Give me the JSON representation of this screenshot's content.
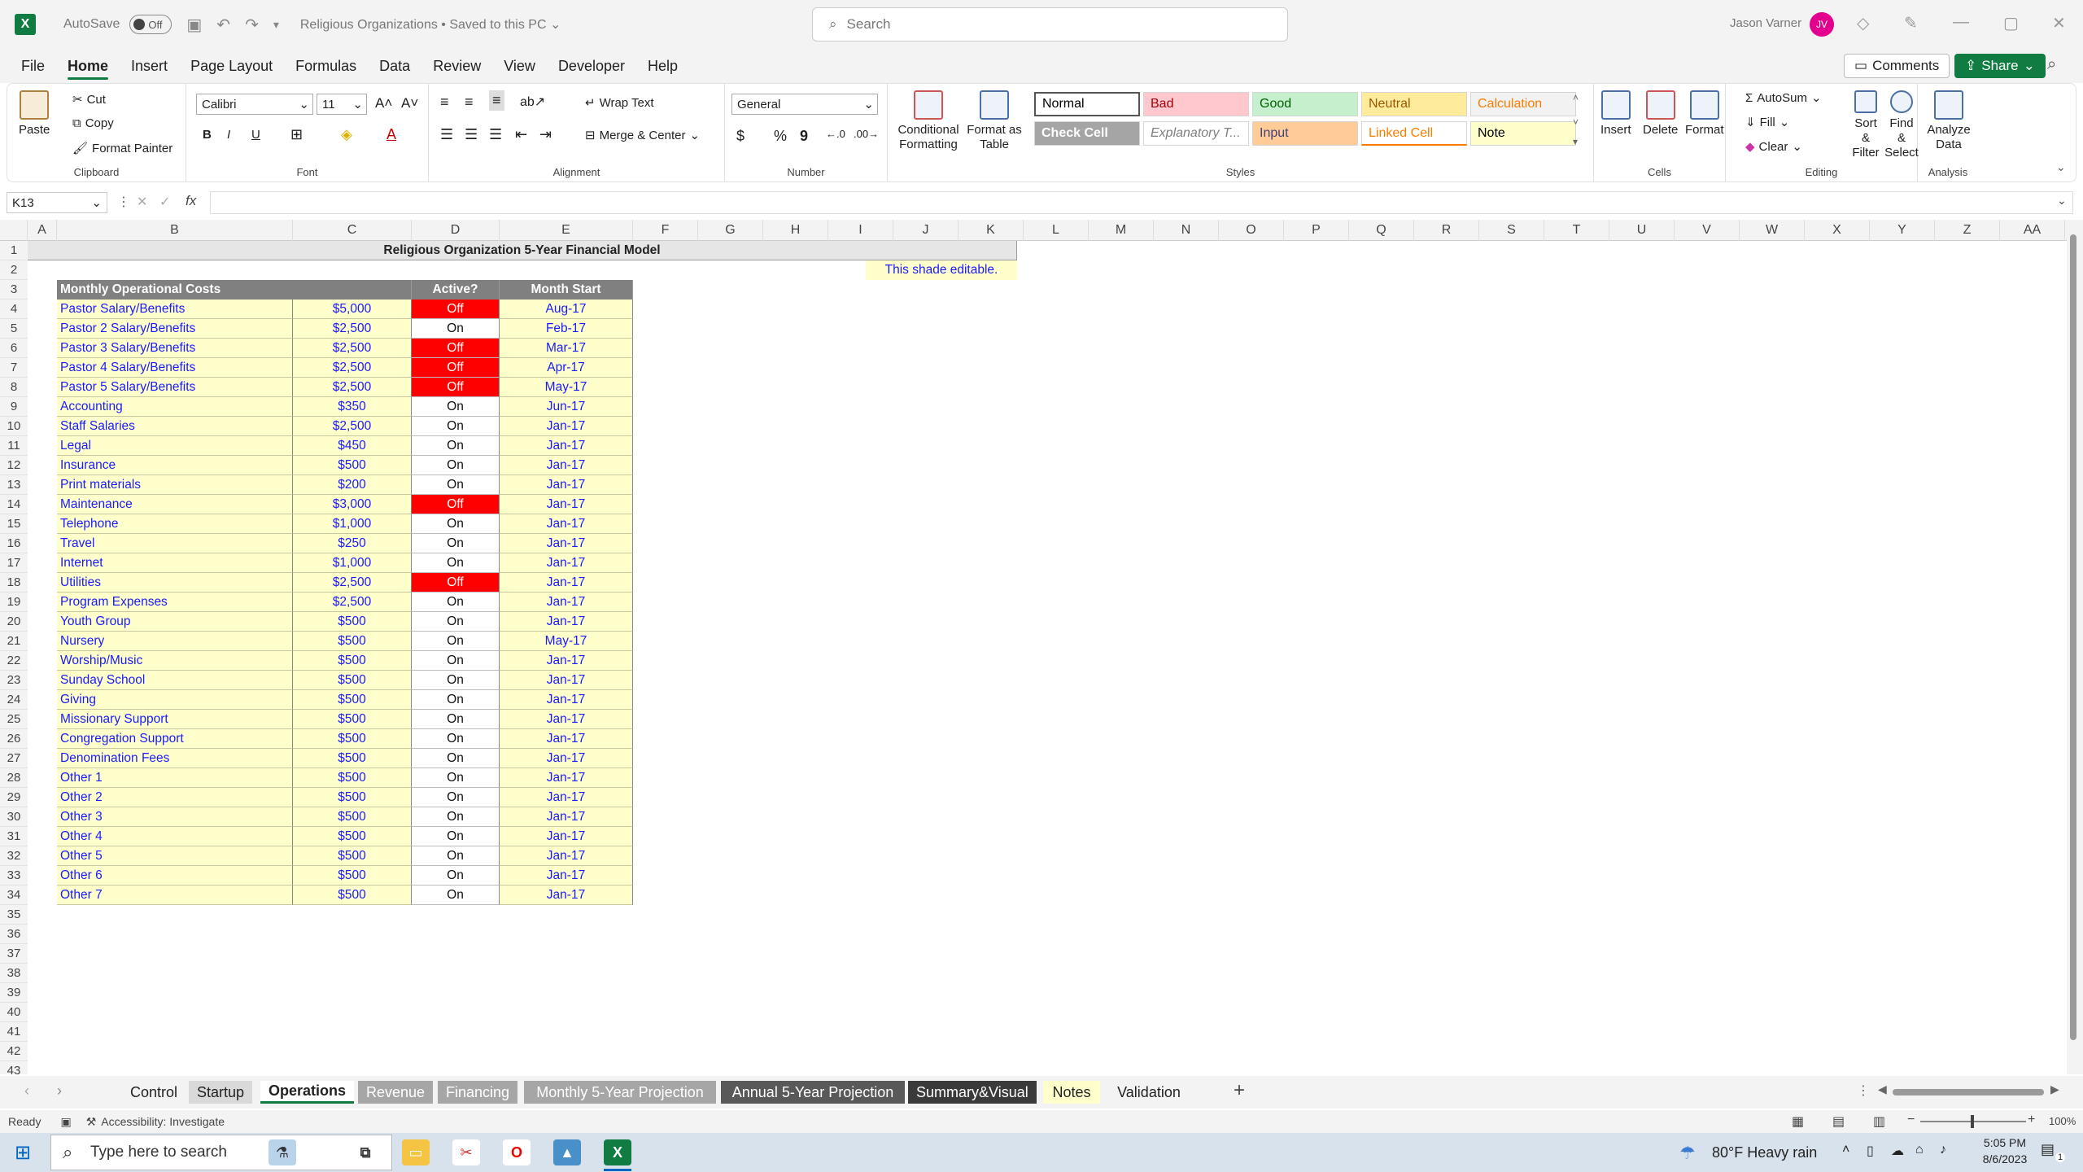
{
  "titlebar": {
    "autosave_label": "AutoSave",
    "autosave_state": "Off",
    "doc_title": "Religious Organizations • Saved to this PC ⌄",
    "search_placeholder": "Search",
    "user_name": "Jason Varner",
    "user_initials": "JV"
  },
  "menu": {
    "items": [
      "File",
      "Home",
      "Insert",
      "Page Layout",
      "Formulas",
      "Data",
      "Review",
      "View",
      "Developer",
      "Help"
    ],
    "active": "Home",
    "comments_label": "Comments",
    "share_label": "Share"
  },
  "ribbon": {
    "clipboard": {
      "paste": "Paste",
      "cut": "Cut",
      "copy": "Copy",
      "format_painter": "Format Painter",
      "label": "Clipboard"
    },
    "font": {
      "name": "Calibri",
      "size": "11",
      "label": "Font",
      "bold": "B",
      "italic": "I",
      "underline": "U"
    },
    "alignment": {
      "wrap": "Wrap Text",
      "merge": "Merge & Center",
      "label": "Alignment"
    },
    "number": {
      "format": "General",
      "label": "Number",
      "currency": "$",
      "percent": "%",
      "comma": "9"
    },
    "styles": {
      "conditional": "Conditional Formatting",
      "format_table": "Format as Table",
      "label": "Styles",
      "cells": [
        {
          "name": "Normal",
          "bg": "#ffffff",
          "fg": "#000000"
        },
        {
          "name": "Bad",
          "bg": "#ffc7ce",
          "fg": "#9c0006"
        },
        {
          "name": "Good",
          "bg": "#c6efce",
          "fg": "#006100"
        },
        {
          "name": "Neutral",
          "bg": "#ffeb9c",
          "fg": "#9c5700"
        },
        {
          "name": "Calculation",
          "bg": "#f2f2f2",
          "fg": "#fa7d00"
        },
        {
          "name": "Check Cell",
          "bg": "#a5a5a5",
          "fg": "#ffffff"
        },
        {
          "name": "Explanatory T...",
          "bg": "#ffffff",
          "fg": "#7f7f7f"
        },
        {
          "name": "Input",
          "bg": "#ffcc99",
          "fg": "#3f3f76"
        },
        {
          "name": "Linked Cell",
          "bg": "#ffffff",
          "fg": "#fa7d00"
        },
        {
          "name": "Note",
          "bg": "#ffffcc",
          "fg": "#000000"
        }
      ]
    },
    "cells": {
      "insert": "Insert",
      "delete": "Delete",
      "format": "Format",
      "label": "Cells"
    },
    "editing": {
      "autosum": "AutoSum",
      "fill": "Fill",
      "clear": "Clear",
      "sort": "Sort & Filter",
      "find": "Find & Select",
      "label": "Editing"
    },
    "analysis": {
      "analyze": "Analyze Data",
      "label": "Analysis"
    }
  },
  "formula": {
    "namebox": "K13",
    "fx": "fx",
    "value": ""
  },
  "columns": [
    "A",
    "B",
    "C",
    "D",
    "E",
    "F",
    "G",
    "H",
    "I",
    "J",
    "K",
    "L",
    "M",
    "N",
    "O",
    "P",
    "Q",
    "R",
    "S",
    "T",
    "U",
    "V",
    "W",
    "X",
    "Y",
    "Z",
    "AA"
  ],
  "sheet": {
    "title": "Religious Organization 5-Year Financial Model",
    "note": "This shade editable.",
    "headers": {
      "label": "Monthly Operational Costs",
      "active": "Active?",
      "month": "Month Start"
    },
    "rows": [
      {
        "label": "Pastor Salary/Benefits",
        "amount": "$5,000",
        "active": "Off",
        "month": "Aug-17"
      },
      {
        "label": "Pastor 2 Salary/Benefits",
        "amount": "$2,500",
        "active": "On",
        "month": "Feb-17"
      },
      {
        "label": "Pastor 3 Salary/Benefits",
        "amount": "$2,500",
        "active": "Off",
        "month": "Mar-17"
      },
      {
        "label": "Pastor 4 Salary/Benefits",
        "amount": "$2,500",
        "active": "Off",
        "month": "Apr-17"
      },
      {
        "label": "Pastor 5 Salary/Benefits",
        "amount": "$2,500",
        "active": "Off",
        "month": "May-17"
      },
      {
        "label": "Accounting",
        "amount": "$350",
        "active": "On",
        "month": "Jun-17"
      },
      {
        "label": "Staff Salaries",
        "amount": "$2,500",
        "active": "On",
        "month": "Jan-17"
      },
      {
        "label": "Legal",
        "amount": "$450",
        "active": "On",
        "month": "Jan-17"
      },
      {
        "label": "Insurance",
        "amount": "$500",
        "active": "On",
        "month": "Jan-17"
      },
      {
        "label": "Print materials",
        "amount": "$200",
        "active": "On",
        "month": "Jan-17"
      },
      {
        "label": "Maintenance",
        "amount": "$3,000",
        "active": "Off",
        "month": "Jan-17"
      },
      {
        "label": "Telephone",
        "amount": "$1,000",
        "active": "On",
        "month": "Jan-17"
      },
      {
        "label": "Travel",
        "amount": "$250",
        "active": "On",
        "month": "Jan-17"
      },
      {
        "label": "Internet",
        "amount": "$1,000",
        "active": "On",
        "month": "Jan-17"
      },
      {
        "label": "Utilities",
        "amount": "$2,500",
        "active": "Off",
        "month": "Jan-17"
      },
      {
        "label": "Program Expenses",
        "amount": "$2,500",
        "active": "On",
        "month": "Jan-17"
      },
      {
        "label": "Youth Group",
        "amount": "$500",
        "active": "On",
        "month": "Jan-17"
      },
      {
        "label": "Nursery",
        "amount": "$500",
        "active": "On",
        "month": "May-17"
      },
      {
        "label": "Worship/Music",
        "amount": "$500",
        "active": "On",
        "month": "Jan-17"
      },
      {
        "label": "Sunday School",
        "amount": "$500",
        "active": "On",
        "month": "Jan-17"
      },
      {
        "label": "Giving",
        "amount": "$500",
        "active": "On",
        "month": "Jan-17"
      },
      {
        "label": "Missionary Support",
        "amount": "$500",
        "active": "On",
        "month": "Jan-17"
      },
      {
        "label": "Congregation Support",
        "amount": "$500",
        "active": "On",
        "month": "Jan-17"
      },
      {
        "label": "Denomination Fees",
        "amount": "$500",
        "active": "On",
        "month": "Jan-17"
      },
      {
        "label": "Other 1",
        "amount": "$500",
        "active": "On",
        "month": "Jan-17"
      },
      {
        "label": "Other 2",
        "amount": "$500",
        "active": "On",
        "month": "Jan-17"
      },
      {
        "label": "Other 3",
        "amount": "$500",
        "active": "On",
        "month": "Jan-17"
      },
      {
        "label": "Other 4",
        "amount": "$500",
        "active": "On",
        "month": "Jan-17"
      },
      {
        "label": "Other 5",
        "amount": "$500",
        "active": "On",
        "month": "Jan-17"
      },
      {
        "label": "Other 6",
        "amount": "$500",
        "active": "On",
        "month": "Jan-17"
      },
      {
        "label": "Other 7",
        "amount": "$500",
        "active": "On",
        "month": "Jan-17"
      }
    ]
  },
  "tabs": [
    {
      "name": "Control",
      "style": "plain"
    },
    {
      "name": "Startup",
      "style": "lightgray"
    },
    {
      "name": "Operations",
      "style": "active"
    },
    {
      "name": "Revenue",
      "style": "gray"
    },
    {
      "name": "Financing",
      "style": "gray"
    },
    {
      "name": "Monthly 5-Year Projection",
      "style": "gray"
    },
    {
      "name": "Annual 5-Year Projection",
      "style": "dark"
    },
    {
      "name": "Summary&Visual",
      "style": "darker"
    },
    {
      "name": "Notes",
      "style": "yellow"
    },
    {
      "name": "Validation",
      "style": "plain"
    }
  ],
  "status": {
    "ready": "Ready",
    "accessibility": "Accessibility: Investigate",
    "zoom": "100%"
  },
  "taskbar": {
    "search_placeholder": "Type here to search",
    "weather": "80°F  Heavy rain",
    "time": "5:05 PM",
    "date": "8/6/2023",
    "notif_count": "1"
  },
  "colors": {
    "accent": "#107c41",
    "off_red": "#ff0000",
    "editable_yellow": "#ffffcc",
    "input_blue": "#1a1aff"
  }
}
